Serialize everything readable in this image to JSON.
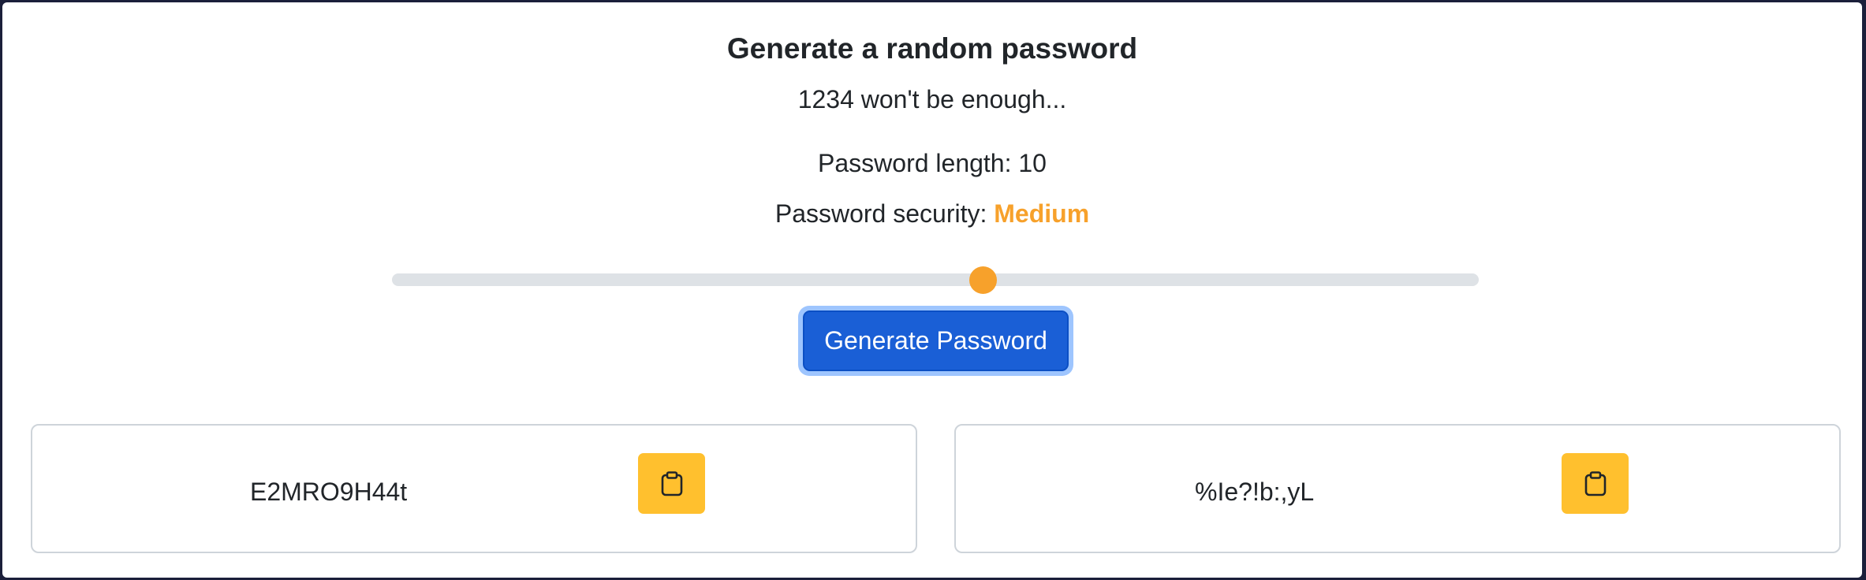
{
  "header": {
    "title": "Generate a random password",
    "subtitle": "1234 won't be enough..."
  },
  "settings": {
    "length_label": "Password length: 10",
    "security_label": "Password security: ",
    "security_value": "Medium",
    "security_color": "#f7a12b",
    "slider_value_fraction": 0.54
  },
  "actions": {
    "generate_label": "Generate Password"
  },
  "passwords": [
    {
      "value": "E2MRO9H44t",
      "copy_icon": "clipboard-icon"
    },
    {
      "value": "%Ie?!b:,yL",
      "copy_icon": "clipboard-icon"
    }
  ],
  "colors": {
    "primary": "#1a5fd6",
    "warning": "#ffc02e",
    "accent": "#f7a12b"
  }
}
